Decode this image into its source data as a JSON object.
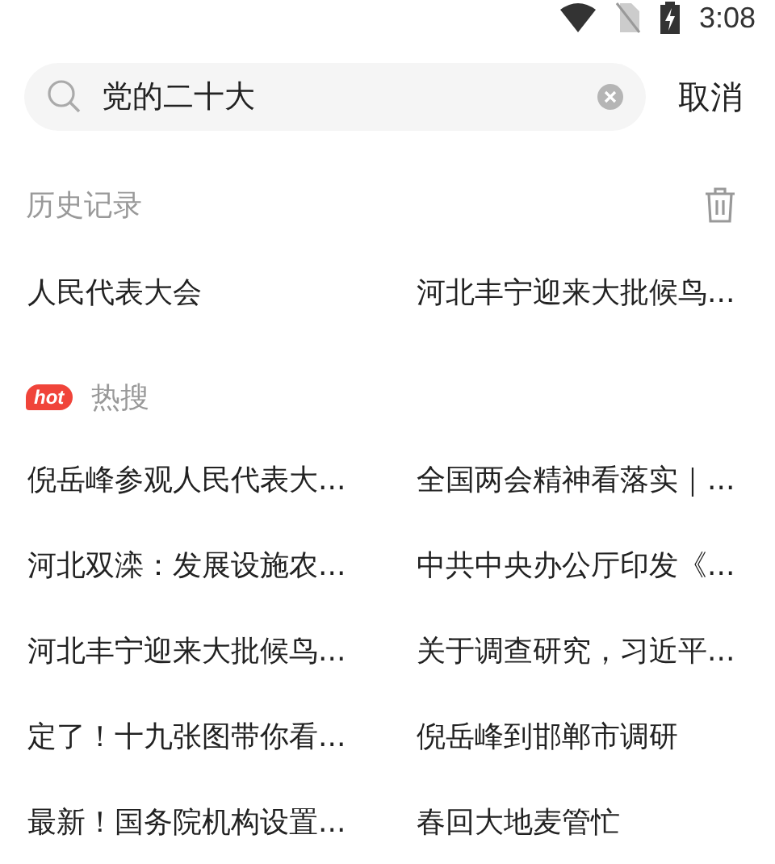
{
  "status_bar": {
    "time": "3:08"
  },
  "search": {
    "value": "党的二十大",
    "cancel": "取消"
  },
  "history": {
    "title": "历史记录",
    "items": [
      "人民代表大会",
      "河北丰宁迎来大批候鸟..."
    ]
  },
  "hot": {
    "badge": "hot",
    "title": "热搜",
    "items": [
      "倪岳峰参观人民代表大...",
      "全国两会精神看落实｜...",
      "河北双滦：发展设施农...",
      "中共中央办公厅印发《...",
      "河北丰宁迎来大批候鸟...",
      "关于调查研究，习近平...",
      "定了！十九张图带你看...",
      "倪岳峰到邯郸市调研",
      "最新！国务院机构设置...",
      "春回大地麦管忙"
    ]
  }
}
